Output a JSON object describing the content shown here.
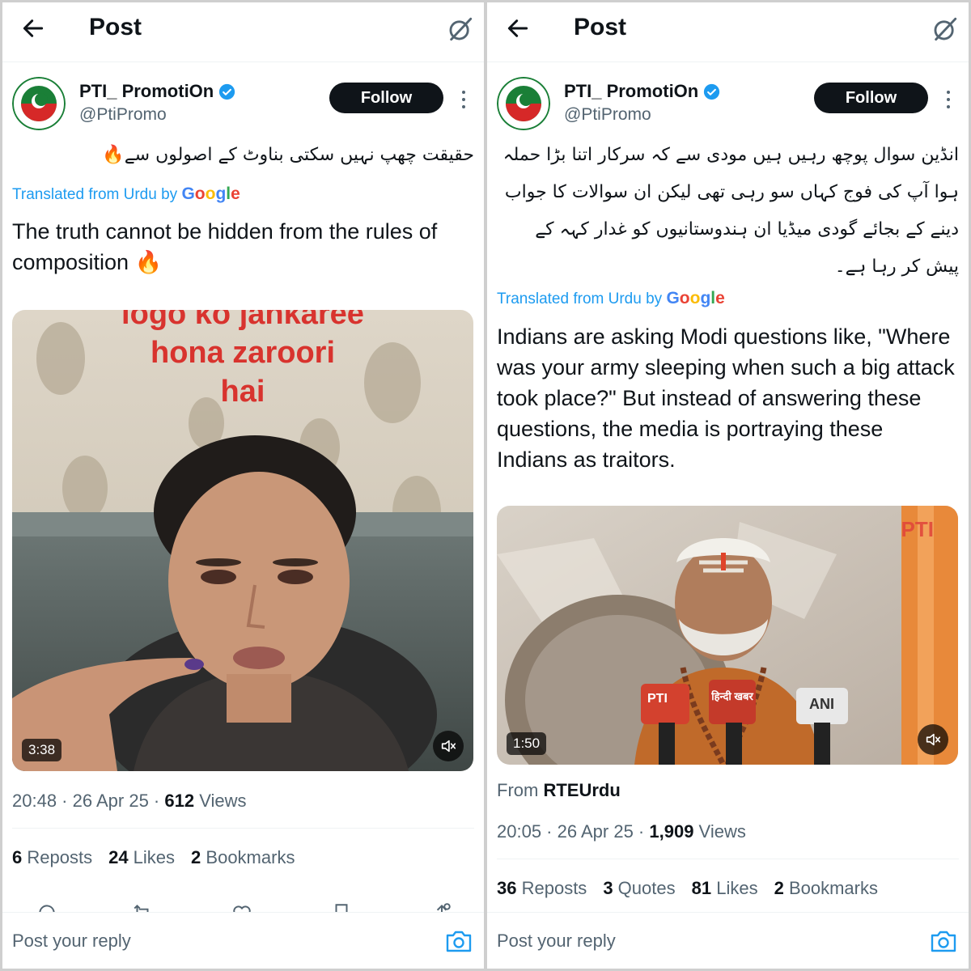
{
  "colors": {
    "accent": "#1d9bf0",
    "text": "#0f1419",
    "secondary": "#536471",
    "follow_bg": "#0f1419"
  },
  "icons": [
    "back-arrow-icon",
    "grok-icon",
    "verified-badge-icon",
    "more-icon",
    "mute-icon",
    "reply-icon",
    "repost-icon",
    "like-icon",
    "bookmark-icon",
    "share-icon",
    "camera-icon",
    "fire-icon"
  ],
  "left": {
    "header": {
      "title": "Post"
    },
    "author": {
      "name": "PTI_ PromotiOn",
      "handle": "@PtiPromo",
      "follow_label": "Follow"
    },
    "urdu_text": "حقیقت چھپ نہیں سکتی بناوٹ کے اصولوں سے🔥",
    "translated": {
      "prefix": "Translated from Urdu by",
      "brand": "Google"
    },
    "english_text": "The truth cannot be hidden from the rules of composition 🔥",
    "video": {
      "duration": "3:38",
      "overlay_lines": [
        "logo ko jankaree",
        "hona zaroori",
        "hai"
      ]
    },
    "meta": {
      "time": "20:48",
      "sep1": " · ",
      "date": "26 Apr 25",
      "sep2": " · ",
      "views": "612",
      "views_label": " Views"
    },
    "stats": [
      {
        "count": "6",
        "label": " Reposts"
      },
      {
        "count": "24",
        "label": " Likes"
      },
      {
        "count": "2",
        "label": " Bookmarks"
      }
    ],
    "reply_placeholder": "Post your reply"
  },
  "right": {
    "header": {
      "title": "Post"
    },
    "author": {
      "name": "PTI_ PromotiOn",
      "handle": "@PtiPromo",
      "follow_label": "Follow"
    },
    "urdu_text": "انڈین سوال پوچھ رہیں ہیں مودی سے کہ سرکار اتنا بڑا حملہ ہوا آپ کی فوج کہاں سو رہی تھی لیکن ان سوالات کا جواب دینے کے بجائے گودی میڈیا ان ہندوستانیوں کو غدار کہہ کے پیش کر رہا ہے۔",
    "translated": {
      "prefix": "Translated from Urdu by",
      "brand": "Google"
    },
    "english_text": "Indians are asking Modi questions like, \"Where was your army sleeping when such a big attack took place?\" But instead of answering these questions, the media is portraying these Indians as traitors.",
    "video": {
      "duration": "1:50",
      "watermark": "PTI",
      "mic_labels": [
        "PTI",
        "हिन्दी खबर",
        "ANI"
      ]
    },
    "source": {
      "prefix": "From ",
      "name": "RTEUrdu"
    },
    "meta": {
      "time": "20:05",
      "sep1": " · ",
      "date": "26 Apr 25",
      "sep2": " · ",
      "views": "1,909",
      "views_label": " Views"
    },
    "stats": [
      {
        "count": "36",
        "label": " Reposts"
      },
      {
        "count": "3",
        "label": " Quotes"
      },
      {
        "count": "81",
        "label": " Likes"
      },
      {
        "count": "2",
        "label": " Bookmarks"
      }
    ],
    "reply_placeholder": "Post your reply"
  }
}
